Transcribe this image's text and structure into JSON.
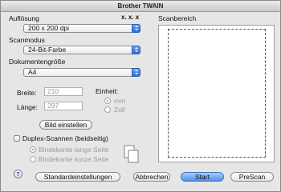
{
  "window": {
    "title": "Brother TWAIN"
  },
  "resolution": {
    "label": "Auflösung",
    "value": "200 x 200 dpi",
    "marker": "x. x. x"
  },
  "scan_mode": {
    "label": "Scanmodus",
    "value": "24-Bit-Farbe"
  },
  "document_size": {
    "label": "Dokumentengröße",
    "value": "A4"
  },
  "width": {
    "label": "Breite:",
    "value": "210"
  },
  "length": {
    "label": "Länge:",
    "value": "297"
  },
  "unit": {
    "label": "Einheit:",
    "options": [
      {
        "label": "mm",
        "selected": true
      },
      {
        "label": "Zoll",
        "selected": false
      }
    ]
  },
  "adjust_image_button": "Bild einstellen",
  "duplex": {
    "label": "Duplex-Scannen (beidseitig)",
    "checked": false,
    "options": [
      {
        "label": "Bindekante lange Seite",
        "selected": true
      },
      {
        "label": "Bindekante kurze Seite",
        "selected": false
      }
    ]
  },
  "scan_area": {
    "label": "Scanbereich"
  },
  "footer": {
    "help_symbol": "?",
    "defaults_button": "Standardeinstellungen",
    "cancel_button": "Abbrechen",
    "start_button": "Start",
    "prescan_button": "PreScan"
  },
  "colors": {
    "accent": "#4f92e6",
    "window_bg": "#e6e6e6"
  }
}
